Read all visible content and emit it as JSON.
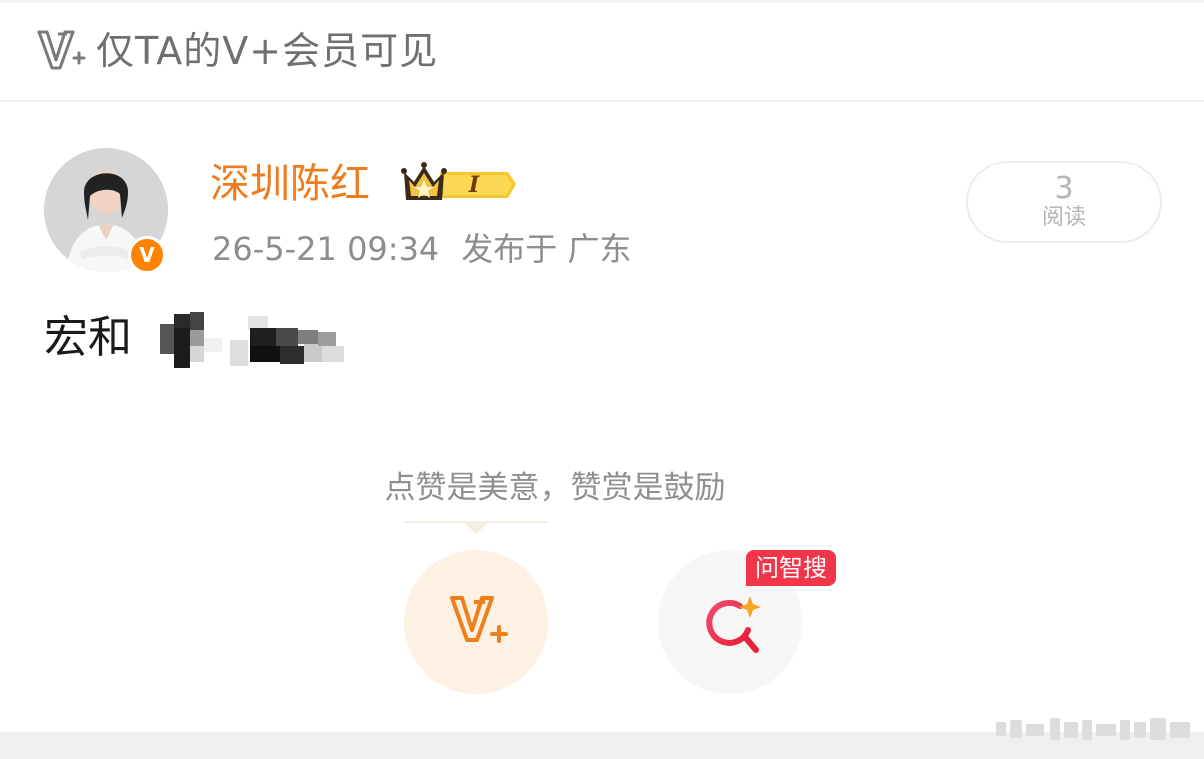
{
  "header": {
    "icon": "vplus-icon",
    "title": "仅TA的V+会员可见"
  },
  "author": {
    "name": "深圳陈红",
    "avatar": "avatar-photo",
    "verified_icon": "verified-v-icon",
    "verified_label": "V",
    "member_badge_icon": "crown-member-badge-icon",
    "member_level": "I",
    "post_date": "26-5-21 09:34",
    "location": "发布于 广东"
  },
  "stats": {
    "read_count": "3",
    "read_label": "阅读"
  },
  "post": {
    "text": "宏和"
  },
  "reward": {
    "tip": "点赞是美意，赞赏是鼓励",
    "vplus_button_icon": "vplus-icon",
    "search_button_icon": "ai-search-icon",
    "search_tag": "问智搜"
  },
  "colors": {
    "accent_orange": "#ef7b1a",
    "badge_orange": "#ff8200",
    "search_red": "#f2364a",
    "text_gray": "#8d8d8d"
  }
}
